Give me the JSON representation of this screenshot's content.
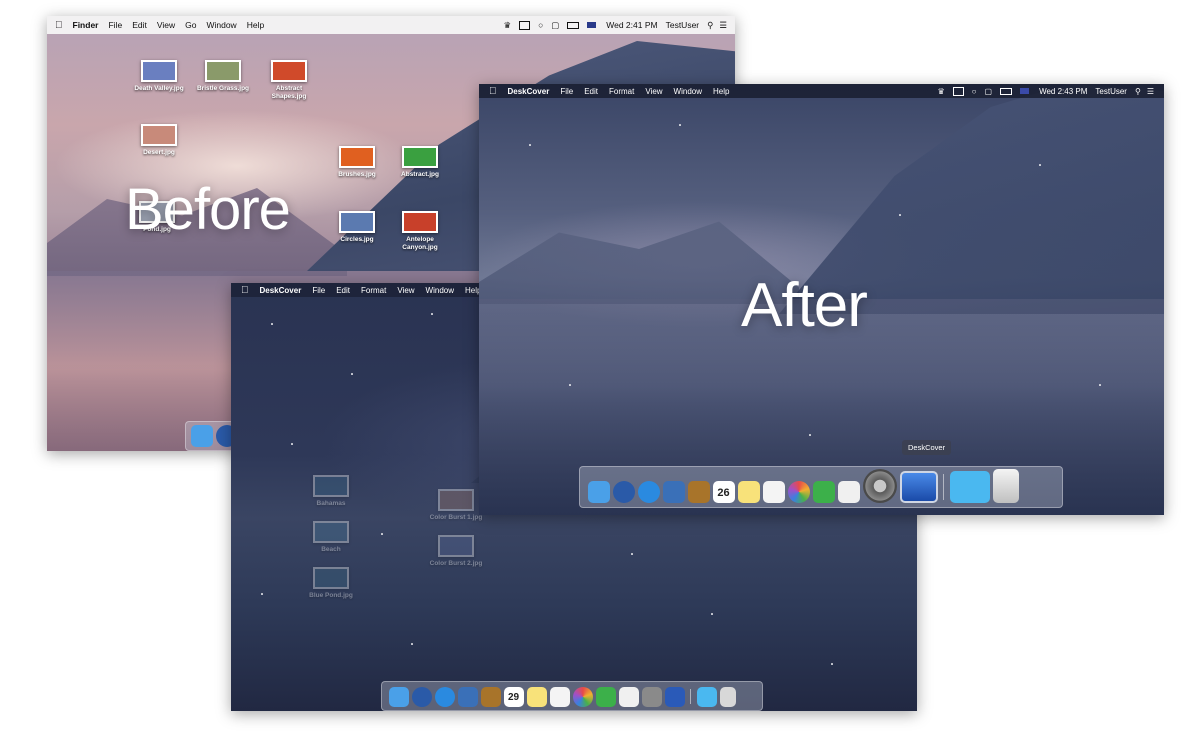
{
  "before": {
    "app_name": "Finder",
    "menus": [
      "File",
      "Edit",
      "View",
      "Go",
      "Window",
      "Help"
    ],
    "status": {
      "datetime": "Wed 2:41 PM",
      "user": "TestUser"
    },
    "label": "Before",
    "desktop_icons": [
      {
        "name": "Death Valley.jpg",
        "color": "#6a7fc0"
      },
      {
        "name": "Bristle Grass.jpg",
        "color": "#8a9a6a"
      },
      {
        "name": "Abstract Shapes.jpg",
        "color": "#d04a2a"
      },
      {
        "name": "Desert.jpg",
        "color": "#c88a7a"
      },
      {
        "name": "Brushes.jpg",
        "color": "#e06020"
      },
      {
        "name": "Abstract.jpg",
        "color": "#3aa040"
      },
      {
        "name": "Circles.jpg",
        "color": "#5b7ab0"
      },
      {
        "name": "Antelope Canyon.jpg",
        "color": "#c8402a"
      },
      {
        "name": "Pond.jpg",
        "color": "#9aa0b0"
      }
    ]
  },
  "deskcover_lower": {
    "app_name": "DeskCover",
    "menus": [
      "File",
      "Edit",
      "Format",
      "View",
      "Window",
      "Help"
    ],
    "desktop_icons": [
      {
        "name": "Bahamas",
        "color": "#3a6a8a"
      },
      {
        "name": "Beach",
        "color": "#4a7a9a"
      },
      {
        "name": "Blue Pond.jpg",
        "color": "#3d6b86"
      },
      {
        "name": "Color Burst 1.jpg",
        "color": "#a07a6a"
      },
      {
        "name": "Color Burst 2.jpg",
        "color": "#5a6a9a"
      }
    ],
    "calendar_day": "29"
  },
  "after": {
    "app_name": "DeskCover",
    "menus": [
      "File",
      "Edit",
      "Format",
      "View",
      "Window",
      "Help"
    ],
    "status": {
      "datetime": "Wed 2:43 PM",
      "user": "TestUser"
    },
    "label": "After",
    "dock_tooltip": "DeskCover",
    "calendar_day": "26"
  },
  "dock_apps": [
    {
      "icon": "finder-icon",
      "color": "#4aa0e8"
    },
    {
      "icon": "launchpad-icon",
      "color": "#2a5aa8"
    },
    {
      "icon": "safari-icon",
      "color": "#2a8ae0"
    },
    {
      "icon": "photo-viewer-icon",
      "color": "#3a70b8"
    },
    {
      "icon": "notebook-icon",
      "color": "#a8742a"
    },
    {
      "icon": "calendar-icon",
      "color": "#ffffff"
    },
    {
      "icon": "notes-icon",
      "color": "#f8e27a"
    },
    {
      "icon": "reminders-icon",
      "color": "#f4f4f4"
    },
    {
      "icon": "photos-icon",
      "color": "#e8a040"
    },
    {
      "icon": "facetime-icon",
      "color": "#3cb04a"
    },
    {
      "icon": "textedit-icon",
      "color": "#f0f0f0"
    },
    {
      "icon": "system-preferences-icon",
      "color": "#8a8a8a"
    },
    {
      "icon": "deskcover-icon",
      "color": "#2a5ab8"
    },
    {
      "icon": "downloads-folder-icon",
      "color": "#4ab8f0"
    },
    {
      "icon": "trash-icon",
      "color": "#d8d8d8"
    }
  ]
}
